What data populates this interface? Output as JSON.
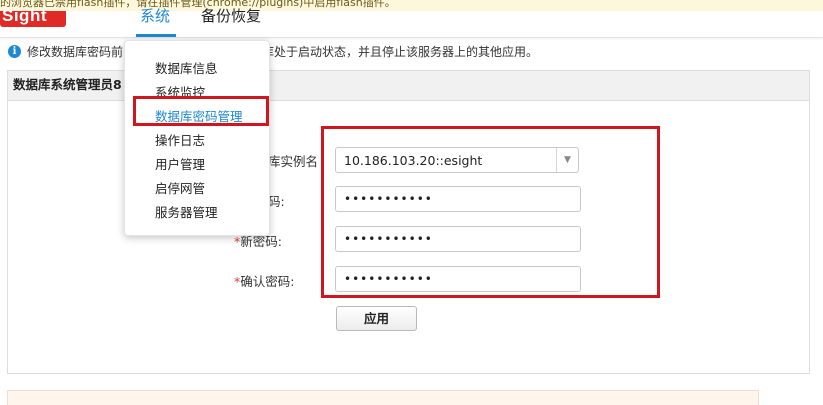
{
  "flash_warning": "的浏览器已禁用flash插件，请在插件管理(chrome://plugins)中启用flash插件。",
  "header": {
    "logo_text": "Sight",
    "tabs": [
      {
        "label": "系统",
        "active": true
      },
      {
        "label": "备份恢复",
        "active": false
      }
    ]
  },
  "info": {
    "prefix": "修改数据库密码前",
    "suffix": "库处于启动状态，并且停止该服务器上的其他应用。"
  },
  "panel": {
    "title": "数据库系统管理员8"
  },
  "dropdown": {
    "items": [
      {
        "label": "数据库信息",
        "active": false
      },
      {
        "label": "系统监控",
        "active": false
      },
      {
        "label": "数据库密码管理",
        "active": true
      },
      {
        "label": "操作日志",
        "active": false
      },
      {
        "label": "用户管理",
        "active": false
      },
      {
        "label": "启停网管",
        "active": false
      },
      {
        "label": "服务器管理",
        "active": false
      }
    ]
  },
  "form": {
    "instance_label": "库实例名",
    "instance_value": "10.186.103.20::esight",
    "old_password_label": "码:",
    "old_password_value": "•••••••••••",
    "new_password_req": "*",
    "new_password_label": "新密码:",
    "new_password_value": "•••••••••••",
    "confirm_req": "*",
    "confirm_label": "确认密码:",
    "confirm_value": "•••••••••••",
    "apply_label": "应用"
  },
  "colors": {
    "accent": "#1e88d4",
    "highlight_box": "#d0161e",
    "logo": "#e02a25"
  }
}
